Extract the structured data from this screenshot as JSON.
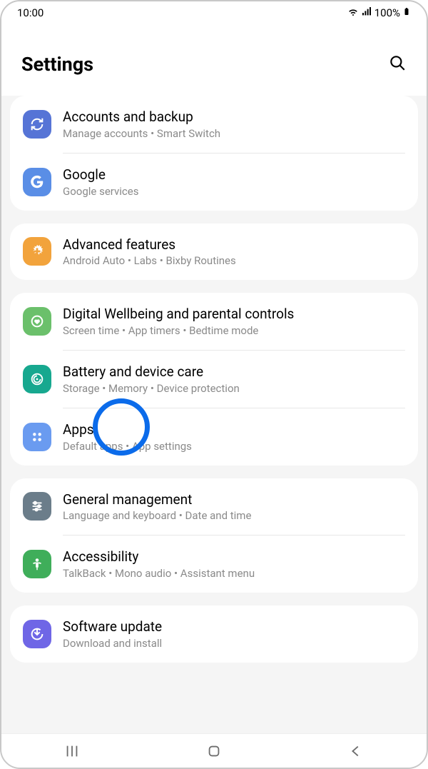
{
  "status": {
    "time": "10:00",
    "battery": "100%"
  },
  "header": {
    "title": "Settings"
  },
  "groups": [
    {
      "items": [
        {
          "id": "accounts-backup",
          "title": "Accounts and backup",
          "sub": "Manage accounts  •  Smart Switch",
          "icon": "sync",
          "bg": "bg-blue"
        },
        {
          "id": "google",
          "title": "Google",
          "sub": "Google services",
          "icon": "google",
          "bg": "bg-gblue"
        }
      ]
    },
    {
      "items": [
        {
          "id": "advanced-features",
          "title": "Advanced features",
          "sub": "Android Auto  •  Labs  •  Bixby Routines",
          "icon": "plus",
          "bg": "bg-orange"
        }
      ]
    },
    {
      "items": [
        {
          "id": "digital-wellbeing",
          "title": "Digital Wellbeing and parental controls",
          "sub": "Screen time  •  App timers  •  Bedtime mode",
          "icon": "heart",
          "bg": "bg-green"
        },
        {
          "id": "battery-device-care",
          "title": "Battery and device care",
          "sub": "Storage  •  Memory  •  Device protection",
          "icon": "care",
          "bg": "bg-teal"
        },
        {
          "id": "apps",
          "title": "Apps",
          "sub": "Default apps  •  App settings",
          "icon": "apps",
          "bg": "bg-lblue"
        }
      ]
    },
    {
      "items": [
        {
          "id": "general-management",
          "title": "General management",
          "sub": "Language and keyboard  •  Date and time",
          "icon": "sliders",
          "bg": "bg-slate"
        },
        {
          "id": "accessibility",
          "title": "Accessibility",
          "sub": "TalkBack  •  Mono audio  •  Assistant menu",
          "icon": "person",
          "bg": "bg-agreen"
        }
      ]
    },
    {
      "items": [
        {
          "id": "software-update",
          "title": "Software update",
          "sub": "Download and install",
          "icon": "update",
          "bg": "bg-violet"
        }
      ]
    }
  ],
  "highlight": {
    "target": "battery-device-care"
  }
}
